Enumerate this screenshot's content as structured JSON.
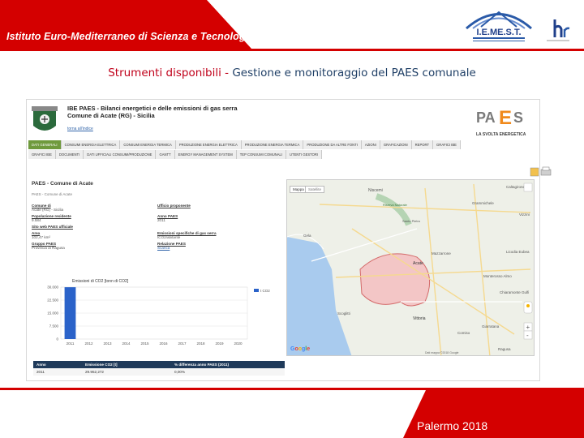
{
  "banner": {
    "title": "Istituto Euro-Mediterraneo di Scienza e Tecnologia",
    "logo_text": "I.E.ME.S.T."
  },
  "slide_title": {
    "part1": "Strumenti disponibili",
    "separator": " - ",
    "part2": "Gestione e monitoraggio del PAES comunale"
  },
  "screenshot": {
    "header_line1": "IBE PAES - Bilanci energetici e delle emissioni di gas serra",
    "header_line2": "Comune di Acate (RG) - Sicilia",
    "home_link": "torna all'indice",
    "paes_logo": {
      "text": "PAES",
      "sub": "LA SVOLTA ENERGETICA"
    },
    "nav_row1": [
      "DATI GENERALI",
      "CONSUMI ENERGIA ELETTRICA",
      "CONSUMI ENERGIA TERMICA",
      "PRODUZIONE ENERGIA ELETTRICA",
      "PRODUZIONE ENERGIA TERMICA",
      "PRODUZIONE DA ALTRE FONTI",
      "AZIONI",
      "GRAFICAZIONI",
      "REPORT",
      "GRAFICI IBE"
    ],
    "nav_row2": [
      "GRAFICI IBE",
      "DOCUMENTI",
      "DATI UFFICIALI CONSUMI/PRODUZIONE",
      "GANTT",
      "ENERGY MANAGEMENT SYSTEM",
      "TEP CONSUMI COMUNALI",
      "UTENTI GESTORI"
    ],
    "panel_title": "PAES - Comune di Acate",
    "panel_subtitle": "PAES - Comune di Acate",
    "info": [
      {
        "k": "Comune di",
        "v": "Acate (RG) - Sicilia",
        "k2": "Ufficio proponente",
        "v2": ""
      },
      {
        "k": "Popolazione residente",
        "v": "9.584",
        "k2": "Anno PAES",
        "v2": "2011"
      },
      {
        "k": "Sito web PAES ufficiale",
        "v": "",
        "k2": "",
        "v2": ""
      },
      {
        "k": "Area",
        "v": "102,47 km²",
        "k2": "Emissioni specifiche di gas serra",
        "v2": "tCO2/abitante"
      },
      {
        "k": "Gruppo PAES",
        "v": "Provincia di Ragusa",
        "k2": "Relazione PAES",
        "v2": "Scarica"
      }
    ],
    "chart_title": "Emissioni di CO2 [tonn di CO2]",
    "table": {
      "headers": [
        "Anno",
        "Emissione CO2 [t]",
        "% differenza anno PAES (2011)"
      ],
      "rows": [
        [
          "2011",
          "29.952,272",
          "0,00%"
        ]
      ]
    },
    "map": {
      "btn_map": "Mappa",
      "btn_sat": "Satellite",
      "places": [
        "Niscemi",
        "Riserva Naturale",
        "Santo Pietro",
        "Mazzarrone",
        "Licodia Eubea",
        "Grammichele",
        "Caltagirone",
        "Vizzini",
        "Acate",
        "Vittoria",
        "Comiso",
        "Chiaramonte Gulfi",
        "Gela",
        "Scoglitti",
        "Ragusa",
        "Monterosso Almo",
        "Giarratana"
      ],
      "google": [
        "G",
        "o",
        "o",
        "g",
        "l",
        "e"
      ],
      "copyright": "Dati mappa ©2018 Google"
    }
  },
  "chart_data": {
    "type": "bar",
    "title": "Emissioni di CO2 [tonn di CO2]",
    "categories": [
      "2011",
      "2012",
      "2013",
      "2014",
      "2015",
      "2016",
      "2017",
      "2018",
      "2019",
      "2020"
    ],
    "series": [
      {
        "name": "t CO2",
        "values": [
          29952,
          0,
          0,
          0,
          0,
          0,
          0,
          0,
          0,
          0
        ]
      }
    ],
    "yticks": [
      "30.000",
      "22.500",
      "15.000",
      "7.500",
      "0"
    ],
    "ylim": [
      0,
      30000
    ]
  },
  "footer": {
    "text": "Palermo 2018"
  },
  "colors": {
    "brand_red": "#d40000",
    "nav_active": "#6f9a3c",
    "bar": "#2a62c9",
    "table_header": "#1f3a5a"
  }
}
